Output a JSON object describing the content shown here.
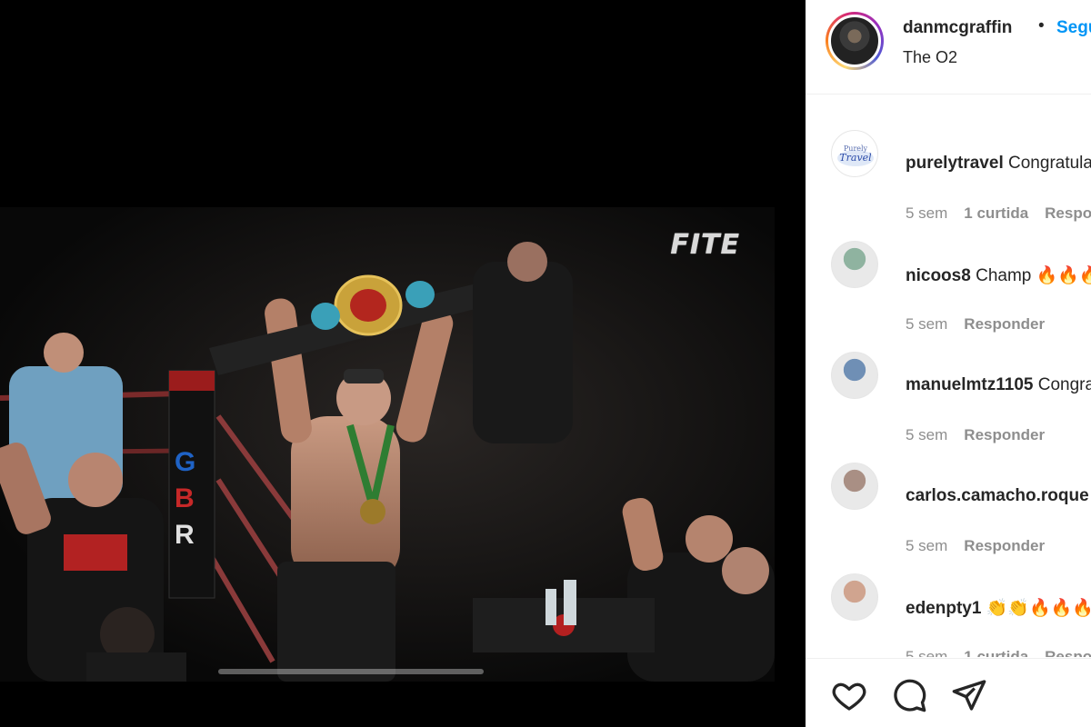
{
  "video": {
    "watermark": "FITE",
    "progress_fraction": 0.0
  },
  "post_header": {
    "username": "danmcgraffin",
    "separator": "•",
    "follow_label": "Seguir",
    "location": "The O2"
  },
  "comments": [
    {
      "username": "purelytravel",
      "text": "Congratulations",
      "time": "5 sem",
      "likes": "1 curtida",
      "reply": "Responder",
      "avatar_icon": "purely-travel-logo"
    },
    {
      "username": "nicoos8",
      "text": "Champ 🔥🔥🔥",
      "time": "5 sem",
      "likes": "",
      "reply": "Responder",
      "avatar_icon": "user-photo"
    },
    {
      "username": "manuelmtz1105",
      "text": "Congrats",
      "time": "5 sem",
      "likes": "",
      "reply": "Responder",
      "avatar_icon": "user-photo"
    },
    {
      "username": "carlos.camacho.roque",
      "text": "",
      "time": "5 sem",
      "likes": "",
      "reply": "Responder",
      "avatar_icon": "user-photo"
    },
    {
      "username": "edenpty1",
      "text": "👏👏🔥🔥🔥🔥",
      "time": "5 sem",
      "likes": "1 curtida",
      "reply": "Responder",
      "avatar_icon": "user-photo"
    }
  ],
  "actions": {
    "like_icon": "heart-icon",
    "comment_icon": "comment-icon",
    "share_icon": "share-icon"
  },
  "colors": {
    "follow_blue": "#0095f6",
    "text": "#262626",
    "muted": "#8e8e8e"
  }
}
